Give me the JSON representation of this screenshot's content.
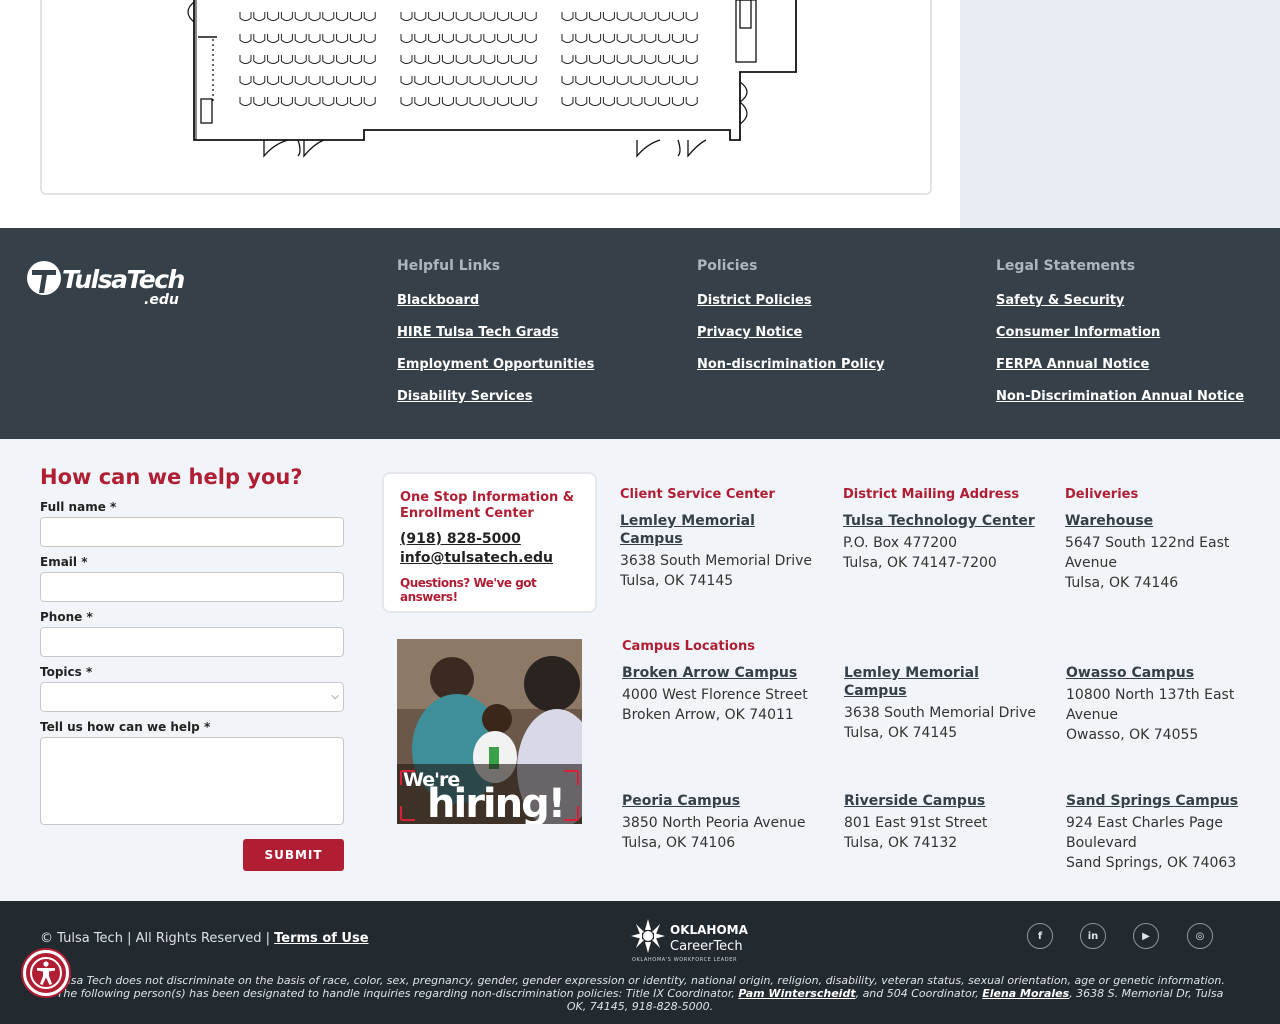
{
  "footer": {
    "logo_text": "TulsaTech.edu",
    "columns": [
      {
        "heading": "Helpful Links",
        "links": [
          "Blackboard",
          "HIRE Tulsa Tech Grads",
          "Employment Opportunities",
          "Disability Services"
        ]
      },
      {
        "heading": "Policies",
        "links": [
          "District Policies",
          "Privacy Notice",
          "Non-discrimination Policy"
        ]
      },
      {
        "heading": "Legal Statements",
        "links": [
          "Safety & Security",
          "Consumer Information",
          "FERPA Annual Notice",
          "Non-Discrimination Annual Notice"
        ]
      }
    ]
  },
  "form": {
    "title": "How can we help you?",
    "full_name_label": "Full name *",
    "email_label": "Email *",
    "phone_label": "Phone *",
    "topics_label": "Topics *",
    "message_label": "Tell us how can we help *",
    "submit_label": "SUBMIT"
  },
  "one_stop": {
    "title": "One Stop Information & Enrollment Center",
    "phone": "(918) 828-5000",
    "email": "info@tulsatech.edu",
    "tagline": "Questions? We've got answers!"
  },
  "hiring_banner": {
    "line1": "We're",
    "line2": "hiring!"
  },
  "contacts": [
    {
      "heading": "Client Service Center",
      "name": "Lemley Memorial Campus",
      "line1": "3638 South Memorial Drive",
      "line2": "Tulsa, OK 74145"
    },
    {
      "heading": "District Mailing Address",
      "name": "Tulsa Technology Center",
      "line1": "P.O. Box 477200",
      "line2": "Tulsa, OK 74147-7200"
    },
    {
      "heading": "Deliveries",
      "name": "Warehouse",
      "line1": "5647 South 122nd East Avenue",
      "line2": "Tulsa, OK 74146"
    }
  ],
  "campus_heading": "Campus Locations",
  "campuses": [
    {
      "name": "Broken Arrow Campus",
      "line1": "4000 West Florence Street",
      "line2": "Broken Arrow, OK 74011"
    },
    {
      "name": "Lemley Memorial Campus",
      "line1": "3638 South Memorial Drive",
      "line2": "Tulsa, OK 74145"
    },
    {
      "name": "Owasso Campus",
      "line1": "10800 North 137th East Avenue",
      "line2": "Owasso, OK 74055"
    },
    {
      "name": "Peoria Campus",
      "line1": "3850 North Peoria Avenue",
      "line2": "Tulsa, OK 74106"
    },
    {
      "name": "Riverside Campus",
      "line1": "801 East 91st Street",
      "line2": "Tulsa, OK 74132"
    },
    {
      "name": "Sand Springs Campus",
      "line1": "924 East Charles Page Boulevard",
      "line2": "Sand Springs, OK 74063"
    }
  ],
  "bottom": {
    "copyright": "© Tulsa Tech  |  All Rights Reserved  |",
    "terms": "Terms of Use",
    "oct_name_1": "OKLAHOMA",
    "oct_name_2": "CareerTech",
    "oct_tagline": "OKLAHOMA'S WORKFORCE LEADER",
    "disclaimer_1": "Tulsa Tech does not discriminate on the basis of race, color, sex, pregnancy, gender, gender expression or identity, national origin, religion, disability, veteran status, sexual orientation, age or genetic information. The following person(s) has been designated to handle inquiries regarding non-discrimination policies: Title IX Coordinator, ",
    "coordinator_1": "Pam Winterscheidt",
    "disclaimer_2": ", and 504 Coordinator, ",
    "coordinator_2": "Elena Morales",
    "disclaimer_3": ", 3638 S. Memorial Dr, Tulsa OK, 74145, 918-828-5000.",
    "social": [
      {
        "icon": "facebook-icon",
        "glyph": "f"
      },
      {
        "icon": "linkedin-icon",
        "glyph": "in"
      },
      {
        "icon": "youtube-icon",
        "glyph": "▶"
      },
      {
        "icon": "instagram-icon",
        "glyph": "◎"
      }
    ]
  },
  "colors": {
    "brand_red": "#b01e34",
    "footer_dark": "#354048",
    "bottom_dark": "#22292f",
    "band_bg": "#f1f5f9"
  }
}
